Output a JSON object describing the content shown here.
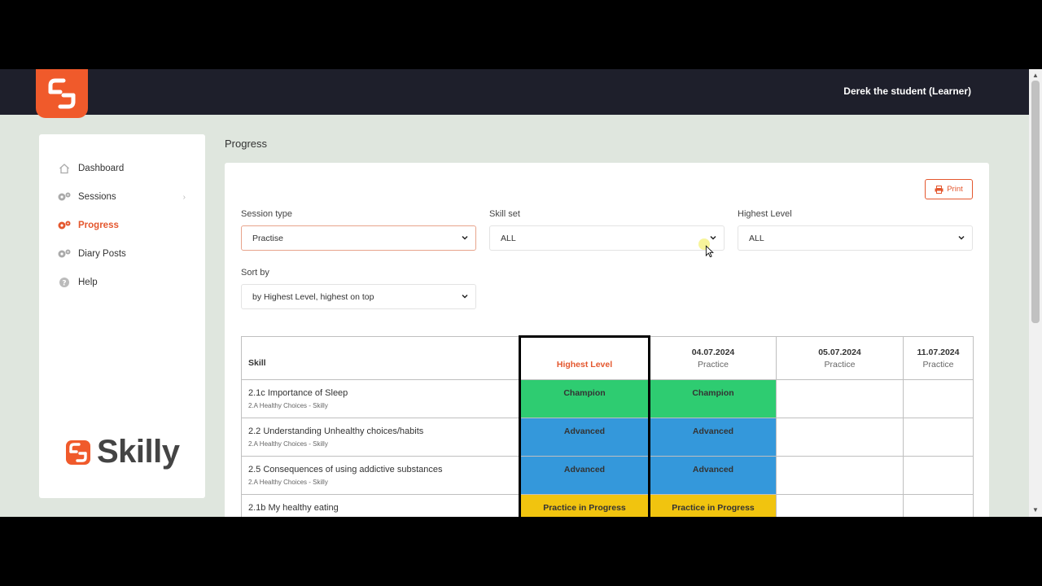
{
  "header": {
    "user_name": "Derek the student (Learner)"
  },
  "sidebar": {
    "items": [
      {
        "label": "Dashboard",
        "icon": "home-icon",
        "active": false
      },
      {
        "label": "Sessions",
        "icon": "gears-icon",
        "active": false
      },
      {
        "label": "Progress",
        "icon": "gears-icon",
        "active": true
      },
      {
        "label": "Diary Posts",
        "icon": "gears-icon",
        "active": false
      },
      {
        "label": "Help",
        "icon": "help-icon",
        "active": false
      }
    ],
    "brand": "Skilly"
  },
  "page": {
    "title": "Progress",
    "print_label": "Print"
  },
  "filters": {
    "session_type": {
      "label": "Session type",
      "value": "Practise"
    },
    "skill_set": {
      "label": "Skill set",
      "value": "ALL"
    },
    "highest_level": {
      "label": "Highest Level",
      "value": "ALL"
    },
    "sort_by": {
      "label": "Sort by",
      "value": "by Highest Level, highest on top"
    }
  },
  "table": {
    "skill_header": "Skill",
    "highest_header": "Highest Level",
    "dates": [
      {
        "date": "04.07.2024",
        "type": "Practice"
      },
      {
        "date": "05.07.2024",
        "type": "Practice"
      },
      {
        "date": "11.07.2024",
        "type": "Practice"
      }
    ],
    "rows": [
      {
        "skill": "2.1c Importance of Sleep",
        "set": "2.A Healthy Choices - Skilly",
        "highest": "Champion",
        "d1": "Champion",
        "d2": "",
        "d3": ""
      },
      {
        "skill": "2.2 Understanding Unhealthy choices/habits",
        "set": "2.A Healthy Choices - Skilly",
        "highest": "Advanced",
        "d1": "Advanced",
        "d2": "",
        "d3": ""
      },
      {
        "skill": "2.5 Consequences of using addictive substances",
        "set": "2.A Healthy Choices - Skilly",
        "highest": "Advanced",
        "d1": "Advanced",
        "d2": "",
        "d3": ""
      },
      {
        "skill": "2.1b My healthy eating",
        "set": "",
        "highest": "Practice in Progress",
        "d1": "Practice in Progress",
        "d2": "",
        "d3": ""
      }
    ]
  },
  "colors": {
    "accent": "#e4572e",
    "champion": "#2ecc71",
    "advanced": "#3498db",
    "in_progress": "#f1c40f"
  }
}
